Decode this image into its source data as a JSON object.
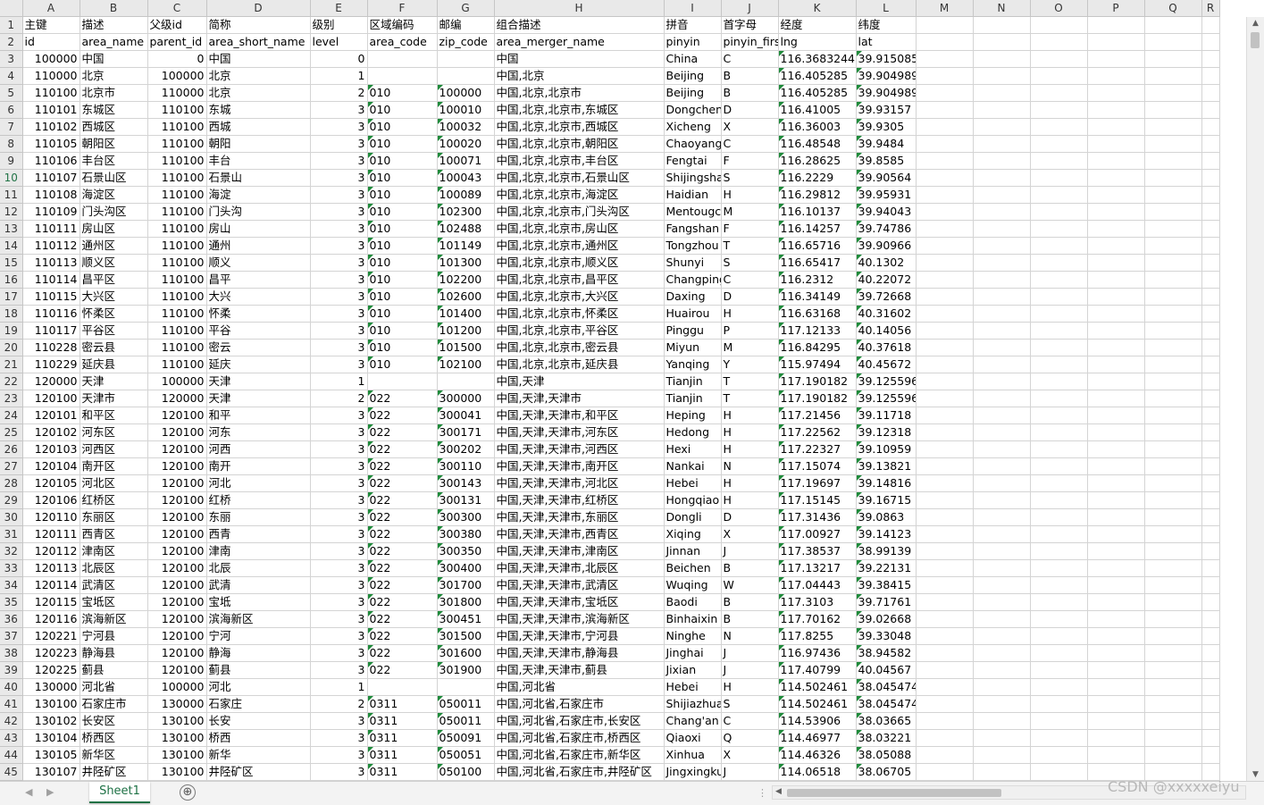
{
  "columns": [
    "A",
    "B",
    "C",
    "D",
    "E",
    "F",
    "G",
    "H",
    "I",
    "J",
    "K",
    "L",
    "M",
    "N",
    "O",
    "P",
    "Q",
    "R"
  ],
  "selected_row": 10,
  "rows": [
    {
      "n": 1,
      "c": [
        "主键",
        "描述",
        "父级id",
        "简称",
        "级别",
        "区域编码",
        "邮编",
        "组合描述",
        "拼音",
        "首字母",
        "经度",
        "纬度"
      ]
    },
    {
      "n": 2,
      "c": [
        "id",
        "area_name",
        "parent_id",
        "area_short_name",
        "level",
        "area_code",
        "zip_code",
        "area_merger_name",
        "pinyin",
        "pinyin_first",
        "lng",
        "lat"
      ]
    },
    {
      "n": 3,
      "c": [
        "100000",
        "中国",
        "0",
        "中国",
        "0",
        "",
        "",
        "中国",
        "China",
        "C",
        "116.3683244",
        "39.915085"
      ]
    },
    {
      "n": 4,
      "c": [
        "110000",
        "北京",
        "100000",
        "北京",
        "1",
        "",
        "",
        "中国,北京",
        "Beijing",
        "B",
        "116.405285",
        "39.904989"
      ]
    },
    {
      "n": 5,
      "c": [
        "110100",
        "北京市",
        "110000",
        "北京",
        "2",
        "010",
        "100000",
        "中国,北京,北京市",
        "Beijing",
        "B",
        "116.405285",
        "39.904989"
      ]
    },
    {
      "n": 6,
      "c": [
        "110101",
        "东城区",
        "110100",
        "东城",
        "3",
        "010",
        "100010",
        "中国,北京,北京市,东城区",
        "Dongchen",
        "D",
        "116.41005",
        "39.93157"
      ]
    },
    {
      "n": 7,
      "c": [
        "110102",
        "西城区",
        "110100",
        "西城",
        "3",
        "010",
        "100032",
        "中国,北京,北京市,西城区",
        "Xicheng",
        "X",
        "116.36003",
        "39.9305"
      ]
    },
    {
      "n": 8,
      "c": [
        "110105",
        "朝阳区",
        "110100",
        "朝阳",
        "3",
        "010",
        "100020",
        "中国,北京,北京市,朝阳区",
        "Chaoyang",
        "C",
        "116.48548",
        "39.9484"
      ]
    },
    {
      "n": 9,
      "c": [
        "110106",
        "丰台区",
        "110100",
        "丰台",
        "3",
        "010",
        "100071",
        "中国,北京,北京市,丰台区",
        "Fengtai",
        "F",
        "116.28625",
        "39.8585"
      ]
    },
    {
      "n": 10,
      "c": [
        "110107",
        "石景山区",
        "110100",
        "石景山",
        "3",
        "010",
        "100043",
        "中国,北京,北京市,石景山区",
        "Shijingsha",
        "S",
        "116.2229",
        "39.90564"
      ]
    },
    {
      "n": 11,
      "c": [
        "110108",
        "海淀区",
        "110100",
        "海淀",
        "3",
        "010",
        "100089",
        "中国,北京,北京市,海淀区",
        "Haidian",
        "H",
        "116.29812",
        "39.95931"
      ]
    },
    {
      "n": 12,
      "c": [
        "110109",
        "门头沟区",
        "110100",
        "门头沟",
        "3",
        "010",
        "102300",
        "中国,北京,北京市,门头沟区",
        "Mentougc",
        "M",
        "116.10137",
        "39.94043"
      ]
    },
    {
      "n": 13,
      "c": [
        "110111",
        "房山区",
        "110100",
        "房山",
        "3",
        "010",
        "102488",
        "中国,北京,北京市,房山区",
        "Fangshan",
        "F",
        "116.14257",
        "39.74786"
      ]
    },
    {
      "n": 14,
      "c": [
        "110112",
        "通州区",
        "110100",
        "通州",
        "3",
        "010",
        "101149",
        "中国,北京,北京市,通州区",
        "Tongzhou",
        "T",
        "116.65716",
        "39.90966"
      ]
    },
    {
      "n": 15,
      "c": [
        "110113",
        "顺义区",
        "110100",
        "顺义",
        "3",
        "010",
        "101300",
        "中国,北京,北京市,顺义区",
        "Shunyi",
        "S",
        "116.65417",
        "40.1302"
      ]
    },
    {
      "n": 16,
      "c": [
        "110114",
        "昌平区",
        "110100",
        "昌平",
        "3",
        "010",
        "102200",
        "中国,北京,北京市,昌平区",
        "Changping",
        "C",
        "116.2312",
        "40.22072"
      ]
    },
    {
      "n": 17,
      "c": [
        "110115",
        "大兴区",
        "110100",
        "大兴",
        "3",
        "010",
        "102600",
        "中国,北京,北京市,大兴区",
        "Daxing",
        "D",
        "116.34149",
        "39.72668"
      ]
    },
    {
      "n": 18,
      "c": [
        "110116",
        "怀柔区",
        "110100",
        "怀柔",
        "3",
        "010",
        "101400",
        "中国,北京,北京市,怀柔区",
        "Huairou",
        "H",
        "116.63168",
        "40.31602"
      ]
    },
    {
      "n": 19,
      "c": [
        "110117",
        "平谷区",
        "110100",
        "平谷",
        "3",
        "010",
        "101200",
        "中国,北京,北京市,平谷区",
        "Pinggu",
        "P",
        "117.12133",
        "40.14056"
      ]
    },
    {
      "n": 20,
      "c": [
        "110228",
        "密云县",
        "110100",
        "密云",
        "3",
        "010",
        "101500",
        "中国,北京,北京市,密云县",
        "Miyun",
        "M",
        "116.84295",
        "40.37618"
      ]
    },
    {
      "n": 21,
      "c": [
        "110229",
        "延庆县",
        "110100",
        "延庆",
        "3",
        "010",
        "102100",
        "中国,北京,北京市,延庆县",
        "Yanqing",
        "Y",
        "115.97494",
        "40.45672"
      ]
    },
    {
      "n": 22,
      "c": [
        "120000",
        "天津",
        "100000",
        "天津",
        "1",
        "",
        "",
        "中国,天津",
        "Tianjin",
        "T",
        "117.190182",
        "39.125596"
      ]
    },
    {
      "n": 23,
      "c": [
        "120100",
        "天津市",
        "120000",
        "天津",
        "2",
        "022",
        "300000",
        "中国,天津,天津市",
        "Tianjin",
        "T",
        "117.190182",
        "39.125596"
      ]
    },
    {
      "n": 24,
      "c": [
        "120101",
        "和平区",
        "120100",
        "和平",
        "3",
        "022",
        "300041",
        "中国,天津,天津市,和平区",
        "Heping",
        "H",
        "117.21456",
        "39.11718"
      ]
    },
    {
      "n": 25,
      "c": [
        "120102",
        "河东区",
        "120100",
        "河东",
        "3",
        "022",
        "300171",
        "中国,天津,天津市,河东区",
        "Hedong",
        "H",
        "117.22562",
        "39.12318"
      ]
    },
    {
      "n": 26,
      "c": [
        "120103",
        "河西区",
        "120100",
        "河西",
        "3",
        "022",
        "300202",
        "中国,天津,天津市,河西区",
        "Hexi",
        "H",
        "117.22327",
        "39.10959"
      ]
    },
    {
      "n": 27,
      "c": [
        "120104",
        "南开区",
        "120100",
        "南开",
        "3",
        "022",
        "300110",
        "中国,天津,天津市,南开区",
        "Nankai",
        "N",
        "117.15074",
        "39.13821"
      ]
    },
    {
      "n": 28,
      "c": [
        "120105",
        "河北区",
        "120100",
        "河北",
        "3",
        "022",
        "300143",
        "中国,天津,天津市,河北区",
        "Hebei",
        "H",
        "117.19697",
        "39.14816"
      ]
    },
    {
      "n": 29,
      "c": [
        "120106",
        "红桥区",
        "120100",
        "红桥",
        "3",
        "022",
        "300131",
        "中国,天津,天津市,红桥区",
        "Hongqiao",
        "H",
        "117.15145",
        "39.16715"
      ]
    },
    {
      "n": 30,
      "c": [
        "120110",
        "东丽区",
        "120100",
        "东丽",
        "3",
        "022",
        "300300",
        "中国,天津,天津市,东丽区",
        "Dongli",
        "D",
        "117.31436",
        "39.0863"
      ]
    },
    {
      "n": 31,
      "c": [
        "120111",
        "西青区",
        "120100",
        "西青",
        "3",
        "022",
        "300380",
        "中国,天津,天津市,西青区",
        "Xiqing",
        "X",
        "117.00927",
        "39.14123"
      ]
    },
    {
      "n": 32,
      "c": [
        "120112",
        "津南区",
        "120100",
        "津南",
        "3",
        "022",
        "300350",
        "中国,天津,天津市,津南区",
        "Jinnan",
        "J",
        "117.38537",
        "38.99139"
      ]
    },
    {
      "n": 33,
      "c": [
        "120113",
        "北辰区",
        "120100",
        "北辰",
        "3",
        "022",
        "300400",
        "中国,天津,天津市,北辰区",
        "Beichen",
        "B",
        "117.13217",
        "39.22131"
      ]
    },
    {
      "n": 34,
      "c": [
        "120114",
        "武清区",
        "120100",
        "武清",
        "3",
        "022",
        "301700",
        "中国,天津,天津市,武清区",
        "Wuqing",
        "W",
        "117.04443",
        "39.38415"
      ]
    },
    {
      "n": 35,
      "c": [
        "120115",
        "宝坻区",
        "120100",
        "宝坻",
        "3",
        "022",
        "301800",
        "中国,天津,天津市,宝坻区",
        "Baodi",
        "B",
        "117.3103",
        "39.71761"
      ]
    },
    {
      "n": 36,
      "c": [
        "120116",
        "滨海新区",
        "120100",
        "滨海新区",
        "3",
        "022",
        "300451",
        "中国,天津,天津市,滨海新区",
        "Binhaixin",
        "B",
        "117.70162",
        "39.02668"
      ]
    },
    {
      "n": 37,
      "c": [
        "120221",
        "宁河县",
        "120100",
        "宁河",
        "3",
        "022",
        "301500",
        "中国,天津,天津市,宁河县",
        "Ninghe",
        "N",
        "117.8255",
        "39.33048"
      ]
    },
    {
      "n": 38,
      "c": [
        "120223",
        "静海县",
        "120100",
        "静海",
        "3",
        "022",
        "301600",
        "中国,天津,天津市,静海县",
        "Jinghai",
        "J",
        "116.97436",
        "38.94582"
      ]
    },
    {
      "n": 39,
      "c": [
        "120225",
        "蓟县",
        "120100",
        "蓟县",
        "3",
        "022",
        "301900",
        "中国,天津,天津市,蓟县",
        "Jixian",
        "J",
        "117.40799",
        "40.04567"
      ]
    },
    {
      "n": 40,
      "c": [
        "130000",
        "河北省",
        "100000",
        "河北",
        "1",
        "",
        "",
        "中国,河北省",
        "Hebei",
        "H",
        "114.502461",
        "38.045474"
      ]
    },
    {
      "n": 41,
      "c": [
        "130100",
        "石家庄市",
        "130000",
        "石家庄",
        "2",
        "0311",
        "050011",
        "中国,河北省,石家庄市",
        "Shijiazhua",
        "S",
        "114.502461",
        "38.045474"
      ]
    },
    {
      "n": 42,
      "c": [
        "130102",
        "长安区",
        "130100",
        "长安",
        "3",
        "0311",
        "050011",
        "中国,河北省,石家庄市,长安区",
        "Chang'an",
        "C",
        "114.53906",
        "38.03665"
      ]
    },
    {
      "n": 43,
      "c": [
        "130104",
        "桥西区",
        "130100",
        "桥西",
        "3",
        "0311",
        "050091",
        "中国,河北省,石家庄市,桥西区",
        "Qiaoxi",
        "Q",
        "114.46977",
        "38.03221"
      ]
    },
    {
      "n": 44,
      "c": [
        "130105",
        "新华区",
        "130100",
        "新华",
        "3",
        "0311",
        "050051",
        "中国,河北省,石家庄市,新华区",
        "Xinhua",
        "X",
        "114.46326",
        "38.05088"
      ]
    },
    {
      "n": 45,
      "c": [
        "130107",
        "井陉矿区",
        "130100",
        "井陉矿区",
        "3",
        "0311",
        "050100",
        "中国,河北省,石家庄市,井陉矿区",
        "Jingxingku",
        "J",
        "114.06518",
        "38.06705"
      ]
    }
  ],
  "footer": {
    "sheet_tab": "Sheet1",
    "add_sheet": "⊕",
    "watermark": "CSDN @xxxxxeiyu"
  }
}
